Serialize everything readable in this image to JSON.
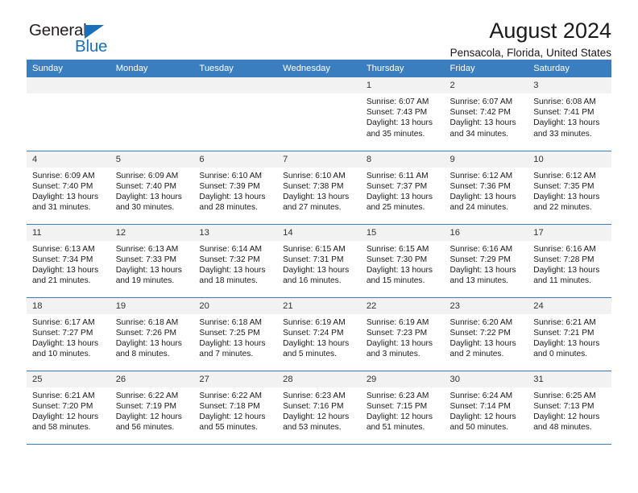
{
  "brand": {
    "name_part1": "General",
    "name_part2": "Blue",
    "triangle_icon": "blue-triangle-logo-mark",
    "color_dark": "#231f20",
    "color_blue": "#1a70b8"
  },
  "header": {
    "title": "August 2024",
    "subtitle": "Pensacola, Florida, United States"
  },
  "theme": {
    "header_row_bg": "#3b7ebf",
    "daynum_bg": "#f2f2f2",
    "separator": "#3b7ebf",
    "text": "#1a1a1a"
  },
  "weekday_headers": [
    "Sunday",
    "Monday",
    "Tuesday",
    "Wednesday",
    "Thursday",
    "Friday",
    "Saturday"
  ],
  "labels": {
    "sunrise": "Sunrise:",
    "sunset": "Sunset:",
    "daylight": "Daylight:"
  },
  "weeks": [
    [
      {
        "day": "",
        "lines": []
      },
      {
        "day": "",
        "lines": []
      },
      {
        "day": "",
        "lines": []
      },
      {
        "day": "",
        "lines": []
      },
      {
        "day": "1",
        "lines": [
          "Sunrise: 6:07 AM",
          "Sunset: 7:43 PM",
          "Daylight: 13 hours",
          "and 35 minutes."
        ]
      },
      {
        "day": "2",
        "lines": [
          "Sunrise: 6:07 AM",
          "Sunset: 7:42 PM",
          "Daylight: 13 hours",
          "and 34 minutes."
        ]
      },
      {
        "day": "3",
        "lines": [
          "Sunrise: 6:08 AM",
          "Sunset: 7:41 PM",
          "Daylight: 13 hours",
          "and 33 minutes."
        ]
      }
    ],
    [
      {
        "day": "4",
        "lines": [
          "Sunrise: 6:09 AM",
          "Sunset: 7:40 PM",
          "Daylight: 13 hours",
          "and 31 minutes."
        ]
      },
      {
        "day": "5",
        "lines": [
          "Sunrise: 6:09 AM",
          "Sunset: 7:40 PM",
          "Daylight: 13 hours",
          "and 30 minutes."
        ]
      },
      {
        "day": "6",
        "lines": [
          "Sunrise: 6:10 AM",
          "Sunset: 7:39 PM",
          "Daylight: 13 hours",
          "and 28 minutes."
        ]
      },
      {
        "day": "7",
        "lines": [
          "Sunrise: 6:10 AM",
          "Sunset: 7:38 PM",
          "Daylight: 13 hours",
          "and 27 minutes."
        ]
      },
      {
        "day": "8",
        "lines": [
          "Sunrise: 6:11 AM",
          "Sunset: 7:37 PM",
          "Daylight: 13 hours",
          "and 25 minutes."
        ]
      },
      {
        "day": "9",
        "lines": [
          "Sunrise: 6:12 AM",
          "Sunset: 7:36 PM",
          "Daylight: 13 hours",
          "and 24 minutes."
        ]
      },
      {
        "day": "10",
        "lines": [
          "Sunrise: 6:12 AM",
          "Sunset: 7:35 PM",
          "Daylight: 13 hours",
          "and 22 minutes."
        ]
      }
    ],
    [
      {
        "day": "11",
        "lines": [
          "Sunrise: 6:13 AM",
          "Sunset: 7:34 PM",
          "Daylight: 13 hours",
          "and 21 minutes."
        ]
      },
      {
        "day": "12",
        "lines": [
          "Sunrise: 6:13 AM",
          "Sunset: 7:33 PM",
          "Daylight: 13 hours",
          "and 19 minutes."
        ]
      },
      {
        "day": "13",
        "lines": [
          "Sunrise: 6:14 AM",
          "Sunset: 7:32 PM",
          "Daylight: 13 hours",
          "and 18 minutes."
        ]
      },
      {
        "day": "14",
        "lines": [
          "Sunrise: 6:15 AM",
          "Sunset: 7:31 PM",
          "Daylight: 13 hours",
          "and 16 minutes."
        ]
      },
      {
        "day": "15",
        "lines": [
          "Sunrise: 6:15 AM",
          "Sunset: 7:30 PM",
          "Daylight: 13 hours",
          "and 15 minutes."
        ]
      },
      {
        "day": "16",
        "lines": [
          "Sunrise: 6:16 AM",
          "Sunset: 7:29 PM",
          "Daylight: 13 hours",
          "and 13 minutes."
        ]
      },
      {
        "day": "17",
        "lines": [
          "Sunrise: 6:16 AM",
          "Sunset: 7:28 PM",
          "Daylight: 13 hours",
          "and 11 minutes."
        ]
      }
    ],
    [
      {
        "day": "18",
        "lines": [
          "Sunrise: 6:17 AM",
          "Sunset: 7:27 PM",
          "Daylight: 13 hours",
          "and 10 minutes."
        ]
      },
      {
        "day": "19",
        "lines": [
          "Sunrise: 6:18 AM",
          "Sunset: 7:26 PM",
          "Daylight: 13 hours",
          "and 8 minutes."
        ]
      },
      {
        "day": "20",
        "lines": [
          "Sunrise: 6:18 AM",
          "Sunset: 7:25 PM",
          "Daylight: 13 hours",
          "and 7 minutes."
        ]
      },
      {
        "day": "21",
        "lines": [
          "Sunrise: 6:19 AM",
          "Sunset: 7:24 PM",
          "Daylight: 13 hours",
          "and 5 minutes."
        ]
      },
      {
        "day": "22",
        "lines": [
          "Sunrise: 6:19 AM",
          "Sunset: 7:23 PM",
          "Daylight: 13 hours",
          "and 3 minutes."
        ]
      },
      {
        "day": "23",
        "lines": [
          "Sunrise: 6:20 AM",
          "Sunset: 7:22 PM",
          "Daylight: 13 hours",
          "and 2 minutes."
        ]
      },
      {
        "day": "24",
        "lines": [
          "Sunrise: 6:21 AM",
          "Sunset: 7:21 PM",
          "Daylight: 13 hours",
          "and 0 minutes."
        ]
      }
    ],
    [
      {
        "day": "25",
        "lines": [
          "Sunrise: 6:21 AM",
          "Sunset: 7:20 PM",
          "Daylight: 12 hours",
          "and 58 minutes."
        ]
      },
      {
        "day": "26",
        "lines": [
          "Sunrise: 6:22 AM",
          "Sunset: 7:19 PM",
          "Daylight: 12 hours",
          "and 56 minutes."
        ]
      },
      {
        "day": "27",
        "lines": [
          "Sunrise: 6:22 AM",
          "Sunset: 7:18 PM",
          "Daylight: 12 hours",
          "and 55 minutes."
        ]
      },
      {
        "day": "28",
        "lines": [
          "Sunrise: 6:23 AM",
          "Sunset: 7:16 PM",
          "Daylight: 12 hours",
          "and 53 minutes."
        ]
      },
      {
        "day": "29",
        "lines": [
          "Sunrise: 6:23 AM",
          "Sunset: 7:15 PM",
          "Daylight: 12 hours",
          "and 51 minutes."
        ]
      },
      {
        "day": "30",
        "lines": [
          "Sunrise: 6:24 AM",
          "Sunset: 7:14 PM",
          "Daylight: 12 hours",
          "and 50 minutes."
        ]
      },
      {
        "day": "31",
        "lines": [
          "Sunrise: 6:25 AM",
          "Sunset: 7:13 PM",
          "Daylight: 12 hours",
          "and 48 minutes."
        ]
      }
    ]
  ]
}
